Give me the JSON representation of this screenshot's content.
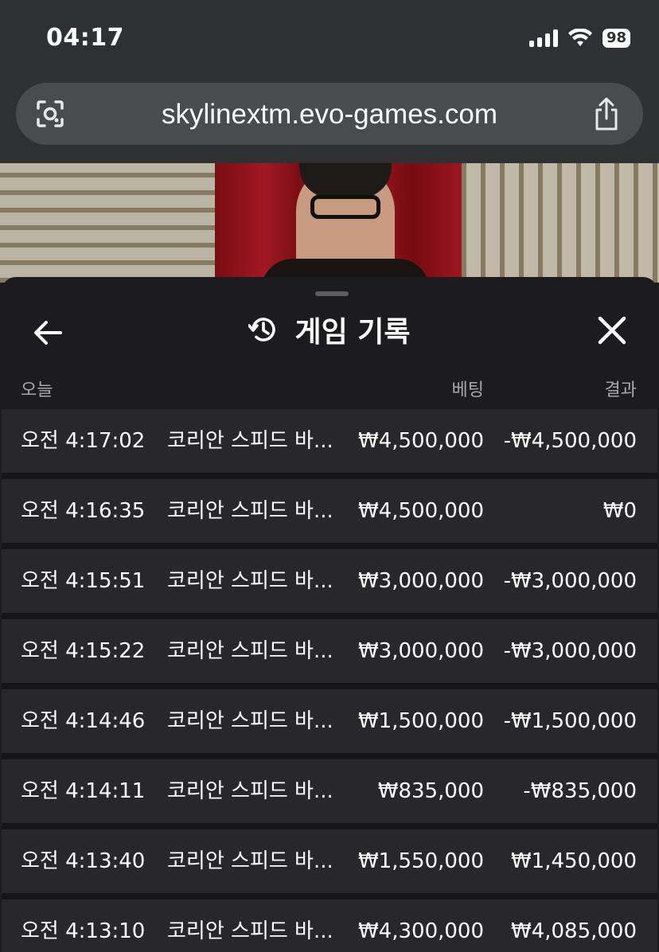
{
  "status_bar": {
    "time": "04:17",
    "battery": "98"
  },
  "browser": {
    "url": "skylinextm.evo-games.com"
  },
  "sheet": {
    "title": "게임 기록",
    "columns": {
      "today": "오늘",
      "bet": "베팅",
      "result": "결과"
    },
    "rows": [
      {
        "time": "오전 4:17:02",
        "game": "코리안 스피드 바...",
        "bet": "₩4,500,000",
        "result": "-₩4,500,000"
      },
      {
        "time": "오전 4:16:35",
        "game": "코리안 스피드 바...",
        "bet": "₩4,500,000",
        "result": "₩0"
      },
      {
        "time": "오전 4:15:51",
        "game": "코리안 스피드 바...",
        "bet": "₩3,000,000",
        "result": "-₩3,000,000"
      },
      {
        "time": "오전 4:15:22",
        "game": "코리안 스피드 바...",
        "bet": "₩3,000,000",
        "result": "-₩3,000,000"
      },
      {
        "time": "오전 4:14:46",
        "game": "코리안 스피드 바...",
        "bet": "₩1,500,000",
        "result": "-₩1,500,000"
      },
      {
        "time": "오전 4:14:11",
        "game": "코리안 스피드 바...",
        "bet": "₩835,000",
        "result": "-₩835,000"
      },
      {
        "time": "오전 4:13:40",
        "game": "코리안 스피드 바...",
        "bet": "₩1,550,000",
        "result": "₩1,450,000"
      },
      {
        "time": "오전 4:13:10",
        "game": "코리안 스피드 바...",
        "bet": "₩4,300,000",
        "result": "₩4,085,000"
      }
    ]
  },
  "icons": {
    "url_left": "screen-capture-icon",
    "url_right": "share-icon",
    "back": "arrow-left-icon",
    "history": "history-icon",
    "close": "close-icon"
  }
}
